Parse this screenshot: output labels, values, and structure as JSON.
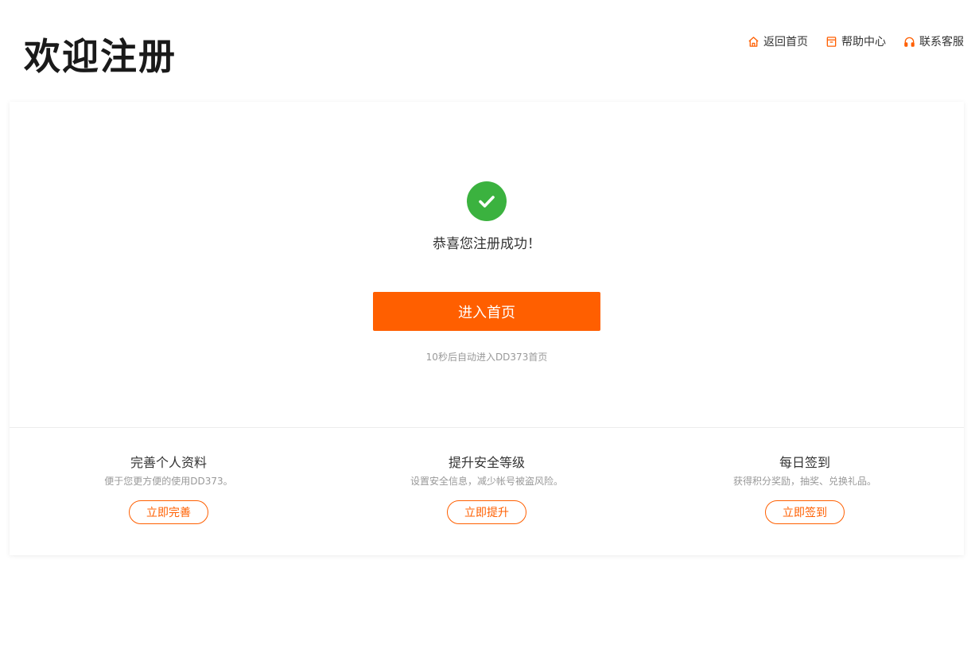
{
  "header": {
    "title": "欢迎注册",
    "nav": {
      "home": "返回首页",
      "help": "帮助中心",
      "service": "联系客服"
    }
  },
  "main": {
    "success_message": "恭喜您注册成功！",
    "enter_button": "进入首页",
    "redirect_note": "10秒后自动进入DD373首页"
  },
  "features": [
    {
      "title": "完善个人资料",
      "desc": "便于您更方便的使用DD373。",
      "button": "立即完善"
    },
    {
      "title": "提升安全等级",
      "desc": "设置安全信息，减少帐号被盗风险。",
      "button": "立即提升"
    },
    {
      "title": "每日签到",
      "desc": "获得积分奖励，抽奖、兑换礼品。",
      "button": "立即签到"
    }
  ],
  "colors": {
    "accent": "#ff5f00",
    "success": "#3bb23f"
  }
}
